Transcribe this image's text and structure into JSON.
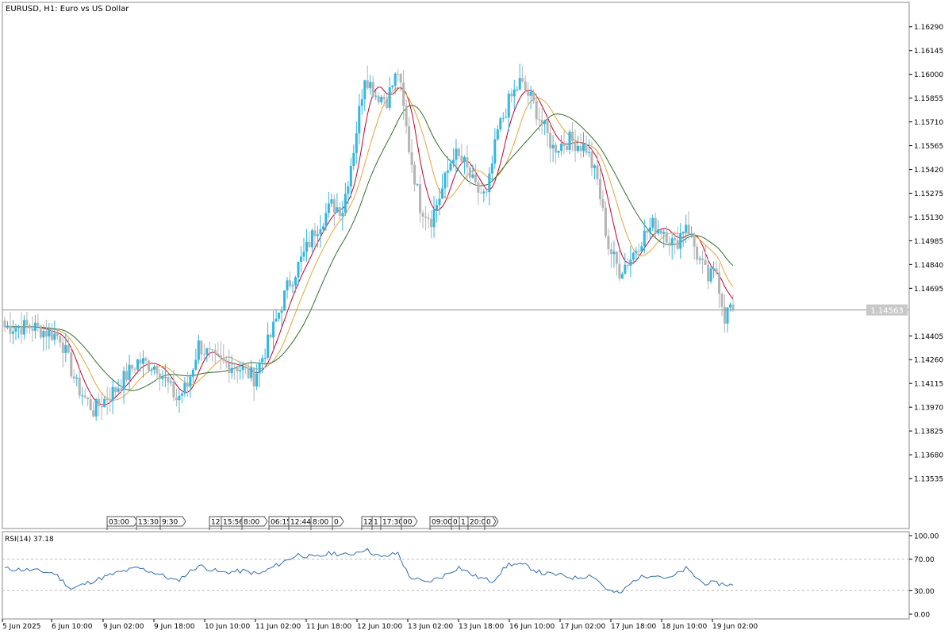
{
  "chart_title": "EURUSD, H1:  Euro vs US Dollar",
  "current_price_label": "1.14563",
  "colors": {
    "bull": "#33b6e0",
    "bear": "#b4b4b4",
    "ma_fast": "#c0002a",
    "ma_mid": "#e8a33a",
    "ma_slow": "#2f6d2f",
    "rsi": "#2f6fb0",
    "grid_dash": "#b8b8b8",
    "frame": "#888888",
    "price_line": "#909090"
  },
  "price_axis_labels": [
    "1.16290",
    "1.16145",
    "1.16000",
    "1.15855",
    "1.15710",
    "1.15565",
    "1.15420",
    "1.15275",
    "1.15130",
    "1.14985",
    "1.14840",
    "1.14695",
    "1.14405",
    "1.14260",
    "1.14115",
    "1.13970",
    "1.13825",
    "1.13680",
    "1.13535"
  ],
  "time_axis_labels": [
    "5 Jun 2025",
    "6 Jun 10:00",
    "9 Jun 02:00",
    "9 Jun 18:00",
    "10 Jun 10:00",
    "11 Jun 02:00",
    "11 Jun 18:00",
    "12 Jun 10:00",
    "13 Jun 02:00",
    "13 Jun 18:00",
    "16 Jun 10:00",
    "17 Jun 02:00",
    "17 Jun 18:00",
    "18 Jun 10:00",
    "19 Jun 02:00"
  ],
  "event_markers": [
    {
      "text": "03:00"
    },
    {
      "text": "13:30"
    },
    {
      "text": "9:30"
    },
    {
      "text": "12"
    },
    {
      "text": "15:56"
    },
    {
      "text": "8:00"
    },
    {
      "text": "06:15"
    },
    {
      "text": "12:44"
    },
    {
      "text": "8:00"
    },
    {
      "text": "0"
    },
    {
      "text": "12"
    },
    {
      "text": "1"
    },
    {
      "text": "17:30"
    },
    {
      "text": "00"
    },
    {
      "text": "09:00"
    },
    {
      "text": "0"
    },
    {
      "text": "1"
    },
    {
      "text": "20:00"
    },
    {
      "text": "0"
    }
  ],
  "rsi_panel": {
    "label": "RSI(14) 37.18",
    "axis_labels": [
      "100.00",
      "70.00",
      "30.00",
      "0.00"
    ]
  },
  "chart_data": {
    "type": "candlestick",
    "symbol": "EURUSD",
    "timeframe": "H1",
    "title": "EURUSD, H1:  Euro vs US Dollar",
    "ylim": [
      1.1339,
      1.164
    ],
    "last_price": 1.14563,
    "close_path": [
      {
        "bar": 0,
        "price": 1.1446
      },
      {
        "bar": 10,
        "price": 1.1446
      },
      {
        "bar": 20,
        "price": 1.144
      },
      {
        "bar": 26,
        "price": 1.141
      },
      {
        "bar": 32,
        "price": 1.1395
      },
      {
        "bar": 40,
        "price": 1.1408
      },
      {
        "bar": 48,
        "price": 1.1425
      },
      {
        "bar": 55,
        "price": 1.1422
      },
      {
        "bar": 62,
        "price": 1.1402
      },
      {
        "bar": 66,
        "price": 1.141
      },
      {
        "bar": 70,
        "price": 1.1435
      },
      {
        "bar": 76,
        "price": 1.1425
      },
      {
        "bar": 84,
        "price": 1.1422
      },
      {
        "bar": 90,
        "price": 1.1415
      },
      {
        "bar": 96,
        "price": 1.144
      },
      {
        "bar": 102,
        "price": 1.147
      },
      {
        "bar": 108,
        "price": 1.149
      },
      {
        "bar": 112,
        "price": 1.1505
      },
      {
        "bar": 118,
        "price": 1.152
      },
      {
        "bar": 122,
        "price": 1.1518
      },
      {
        "bar": 126,
        "price": 1.1555
      },
      {
        "bar": 130,
        "price": 1.16
      },
      {
        "bar": 134,
        "price": 1.1588
      },
      {
        "bar": 138,
        "price": 1.1585
      },
      {
        "bar": 142,
        "price": 1.1602
      },
      {
        "bar": 146,
        "price": 1.1555
      },
      {
        "bar": 150,
        "price": 1.152
      },
      {
        "bar": 154,
        "price": 1.1512
      },
      {
        "bar": 158,
        "price": 1.153
      },
      {
        "bar": 162,
        "price": 1.1552
      },
      {
        "bar": 166,
        "price": 1.1545
      },
      {
        "bar": 170,
        "price": 1.153
      },
      {
        "bar": 174,
        "price": 1.1525
      },
      {
        "bar": 178,
        "price": 1.1565
      },
      {
        "bar": 182,
        "price": 1.1583
      },
      {
        "bar": 186,
        "price": 1.1595
      },
      {
        "bar": 190,
        "price": 1.1585
      },
      {
        "bar": 194,
        "price": 1.157
      },
      {
        "bar": 198,
        "price": 1.1555
      },
      {
        "bar": 204,
        "price": 1.156
      },
      {
        "bar": 210,
        "price": 1.1555
      },
      {
        "bar": 214,
        "price": 1.1535
      },
      {
        "bar": 218,
        "price": 1.1495
      },
      {
        "bar": 222,
        "price": 1.148
      },
      {
        "bar": 226,
        "price": 1.1488
      },
      {
        "bar": 230,
        "price": 1.15
      },
      {
        "bar": 234,
        "price": 1.1508
      },
      {
        "bar": 238,
        "price": 1.1505
      },
      {
        "bar": 242,
        "price": 1.1495
      },
      {
        "bar": 246,
        "price": 1.151
      },
      {
        "bar": 250,
        "price": 1.149
      },
      {
        "bar": 254,
        "price": 1.1475
      },
      {
        "bar": 257,
        "price": 1.148
      },
      {
        "bar": 260,
        "price": 1.1452
      },
      {
        "bar": 263,
        "price": 1.1462
      }
    ],
    "rsi_series": {
      "name": "RSI(14)",
      "current": 37.18,
      "ylim": [
        0,
        100
      ],
      "levels": [
        70,
        30
      ],
      "path": [
        {
          "bar": 0,
          "value": 58
        },
        {
          "bar": 10,
          "value": 56
        },
        {
          "bar": 18,
          "value": 52
        },
        {
          "bar": 24,
          "value": 32
        },
        {
          "bar": 30,
          "value": 40
        },
        {
          "bar": 40,
          "value": 52
        },
        {
          "bar": 48,
          "value": 59
        },
        {
          "bar": 55,
          "value": 52
        },
        {
          "bar": 62,
          "value": 42
        },
        {
          "bar": 70,
          "value": 62
        },
        {
          "bar": 78,
          "value": 53
        },
        {
          "bar": 86,
          "value": 55
        },
        {
          "bar": 92,
          "value": 51
        },
        {
          "bar": 98,
          "value": 62
        },
        {
          "bar": 106,
          "value": 76
        },
        {
          "bar": 112,
          "value": 72
        },
        {
          "bar": 118,
          "value": 78
        },
        {
          "bar": 124,
          "value": 75
        },
        {
          "bar": 130,
          "value": 83
        },
        {
          "bar": 136,
          "value": 72
        },
        {
          "bar": 142,
          "value": 78
        },
        {
          "bar": 146,
          "value": 48
        },
        {
          "bar": 152,
          "value": 40
        },
        {
          "bar": 158,
          "value": 48
        },
        {
          "bar": 164,
          "value": 60
        },
        {
          "bar": 170,
          "value": 48
        },
        {
          "bar": 176,
          "value": 42
        },
        {
          "bar": 182,
          "value": 64
        },
        {
          "bar": 188,
          "value": 62
        },
        {
          "bar": 194,
          "value": 52
        },
        {
          "bar": 200,
          "value": 50
        },
        {
          "bar": 206,
          "value": 46
        },
        {
          "bar": 212,
          "value": 50
        },
        {
          "bar": 218,
          "value": 30
        },
        {
          "bar": 222,
          "value": 26
        },
        {
          "bar": 228,
          "value": 45
        },
        {
          "bar": 234,
          "value": 51
        },
        {
          "bar": 240,
          "value": 45
        },
        {
          "bar": 246,
          "value": 58
        },
        {
          "bar": 252,
          "value": 40
        },
        {
          "bar": 258,
          "value": 39
        },
        {
          "bar": 263,
          "value": 37.18
        }
      ]
    },
    "moving_averages": [
      {
        "name": "",
        "lag": 3
      },
      {
        "name": "",
        "lag": 6
      },
      {
        "name": "",
        "lag": 11
      }
    ]
  }
}
